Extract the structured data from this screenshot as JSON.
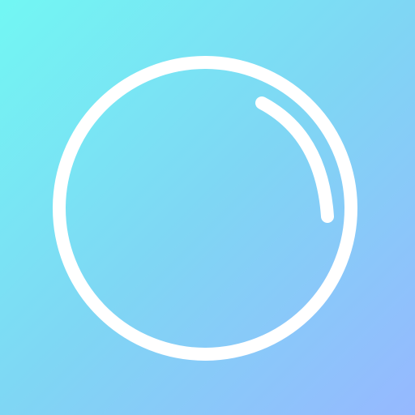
{
  "app_icon": {
    "icon": "bubble-icon",
    "background_gradient": [
      "#72F7F3",
      "#7FD6F4",
      "#96B8FF"
    ],
    "foreground_color": "#FFFFFF"
  }
}
